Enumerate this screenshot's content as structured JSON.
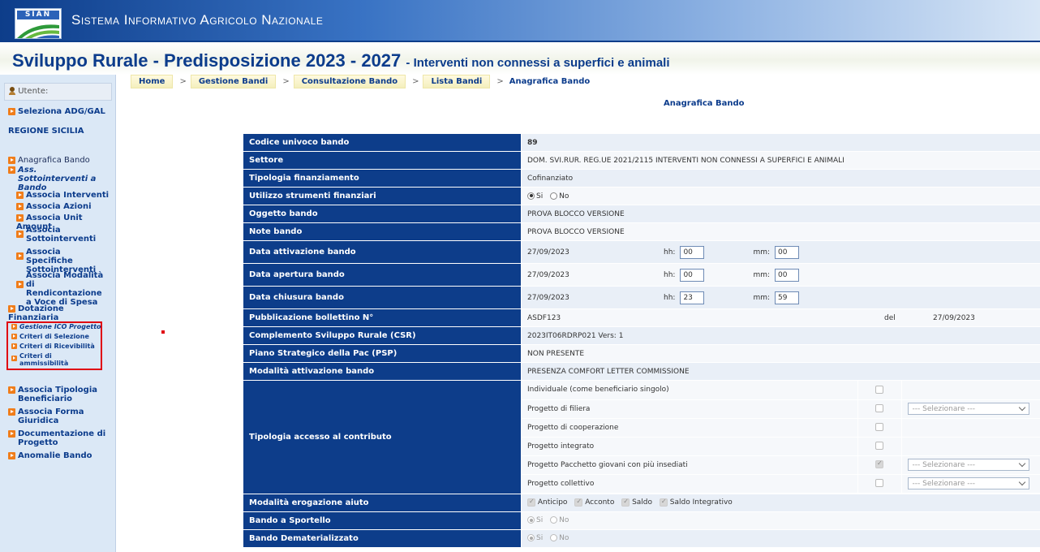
{
  "header": {
    "logo_text": "SIAN",
    "system_title": "Sistema Informativo Agricolo Nazionale",
    "page_title": "Sviluppo Rurale - Predisposizione 2023 - 2027",
    "page_subtitle": "- Interventi non connessi a superfici e animali"
  },
  "sidebar": {
    "user_label": "Utente:",
    "select_adg": "Seleziona ADG/GAL",
    "region": "REGIONE SICILIA",
    "items": {
      "anagrafica": "Anagrafica Bando",
      "ass_sotto": "Ass. Sottointerventi a Bando",
      "associa_interventi": "Associa Interventi",
      "associa_azioni": "Associa Azioni",
      "associa_unit_amount": "Associa Unit Amount",
      "associa_sottointerventi": "Associa Sottointerventi",
      "associa_specifiche": "Associa Specifiche Sottointerventi",
      "associa_modalita": "Associa Modalità di Rendicontazione a Voce di Spesa",
      "dotazione": "Dotazione Finanziaria",
      "gestione_ico": "Gestione ICO Progetto",
      "criteri_selezione": "Criteri di Selezione",
      "criteri_ricevibilita": "Criteri di Ricevibilità",
      "criteri_ammissibilita": "Criteri di ammissibilità",
      "associa_tipologia": "Associa Tipologia Beneficiario",
      "associa_forma": "Associa Forma Giuridica",
      "documentazione": "Documentazione di Progetto",
      "anomalie": "Anomalie Bando"
    }
  },
  "breadcrumb": {
    "home": "Home",
    "gestione": "Gestione Bandi",
    "consultazione": "Consultazione Bando",
    "lista": "Lista Bandi",
    "current": "Anagrafica Bando",
    "separator": ">"
  },
  "section_title": "Anagrafica Bando",
  "form": {
    "codice": {
      "label": "Codice univoco bando",
      "value": "89"
    },
    "settore": {
      "label": "Settore",
      "value": "DOM. SVI.RUR. REG.UE 2021/2115 INTERVENTI NON CONNESSI A SUPERFICI E ANIMALI"
    },
    "tipologia_fin": {
      "label": "Tipologia finanziamento",
      "value": "Cofinanziato"
    },
    "utilizzo": {
      "label": "Utilizzo strumenti finanziari",
      "yes": "Si",
      "no": "No"
    },
    "oggetto": {
      "label": "Oggetto bando",
      "value": "PROVA BLOCCO VERSIONE"
    },
    "note": {
      "label": "Note bando",
      "value": "PROVA BLOCCO VERSIONE"
    },
    "hh_label": "hh:",
    "mm_label": "mm:",
    "attivazione": {
      "label": "Data attivazione bando",
      "date": "27/09/2023",
      "hh": "00",
      "mm": "00"
    },
    "apertura": {
      "label": "Data apertura bando",
      "date": "27/09/2023",
      "hh": "00",
      "mm": "00"
    },
    "chiusura": {
      "label": "Data chiusura bando",
      "date": "27/09/2023",
      "hh": "23",
      "mm": "59"
    },
    "bollettino": {
      "label": "Pubblicazione bollettino N°",
      "value": "ASDF123",
      "del_label": "del",
      "del_value": "27/09/2023"
    },
    "csr": {
      "label": "Complemento Sviluppo Rurale (CSR)",
      "value": "2023IT06RDRP021 Vers: 1"
    },
    "psp": {
      "label": "Piano Strategico della Pac (PSP)",
      "value": "NON PRESENTE"
    },
    "modalita_att": {
      "label": "Modalità attivazione bando",
      "value": "PRESENZA COMFORT LETTER COMMISSIONE"
    },
    "accesso": {
      "label": "Tipologia accesso al contributo",
      "select_placeholder": "--- Selezionare ---",
      "options": [
        "Individuale (come beneficiario singolo)",
        "Progetto di filiera",
        "Progetto di cooperazione",
        "Progetto integrato",
        "Progetto Pacchetto giovani con più insediati",
        "Progetto collettivo"
      ]
    },
    "erogazione": {
      "label": "Modalità erogazione aiuto",
      "options": [
        "Anticipo",
        "Acconto",
        "Saldo",
        "Saldo Integrativo"
      ]
    },
    "sportello": {
      "label": "Bando a Sportello",
      "yes": "Si",
      "no": "No"
    },
    "dematerializzato": {
      "label": "Bando Dematerializzato",
      "yes": "Si",
      "no": "No"
    }
  }
}
